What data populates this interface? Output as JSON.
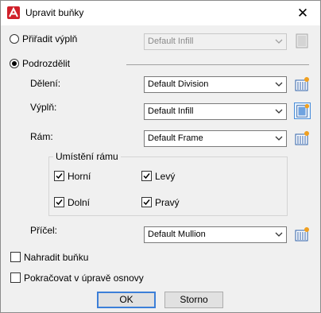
{
  "window": {
    "title": "Upravit buňky",
    "close_symbol": "✕"
  },
  "assign_fill": {
    "label": "Přiřadit výplň",
    "mnemonic_index": 0,
    "dropdown_value": "Default Infill",
    "enabled": false
  },
  "subdivide": {
    "label": "Podrozdělit",
    "selected": true
  },
  "rows": {
    "division": {
      "label": "Dělení:",
      "value": "Default Division"
    },
    "infill": {
      "label": "Výplň:",
      "value": "Default Infill"
    },
    "frame": {
      "label": "Rám:",
      "value": "Default Frame"
    },
    "mullion": {
      "label": "Příčel:",
      "value": "Default Mullion"
    }
  },
  "frame_placement": {
    "title": "Umístění rámu",
    "top": {
      "label": "Horní",
      "checked": true
    },
    "left": {
      "label": "Levý",
      "checked": true
    },
    "bottom": {
      "label": "Dolní",
      "checked": true
    },
    "right": {
      "label": "Pravý",
      "checked": true
    }
  },
  "replace_cell": {
    "label": "Nahradit buňku",
    "checked": false
  },
  "continue_editing": {
    "label": "Pokračovat v úpravě osnovy",
    "checked": false
  },
  "buttons": {
    "ok": "OK",
    "cancel": "Storno"
  },
  "colors": {
    "accent": "#3c7fd8",
    "app_icon": "#d0202a"
  }
}
